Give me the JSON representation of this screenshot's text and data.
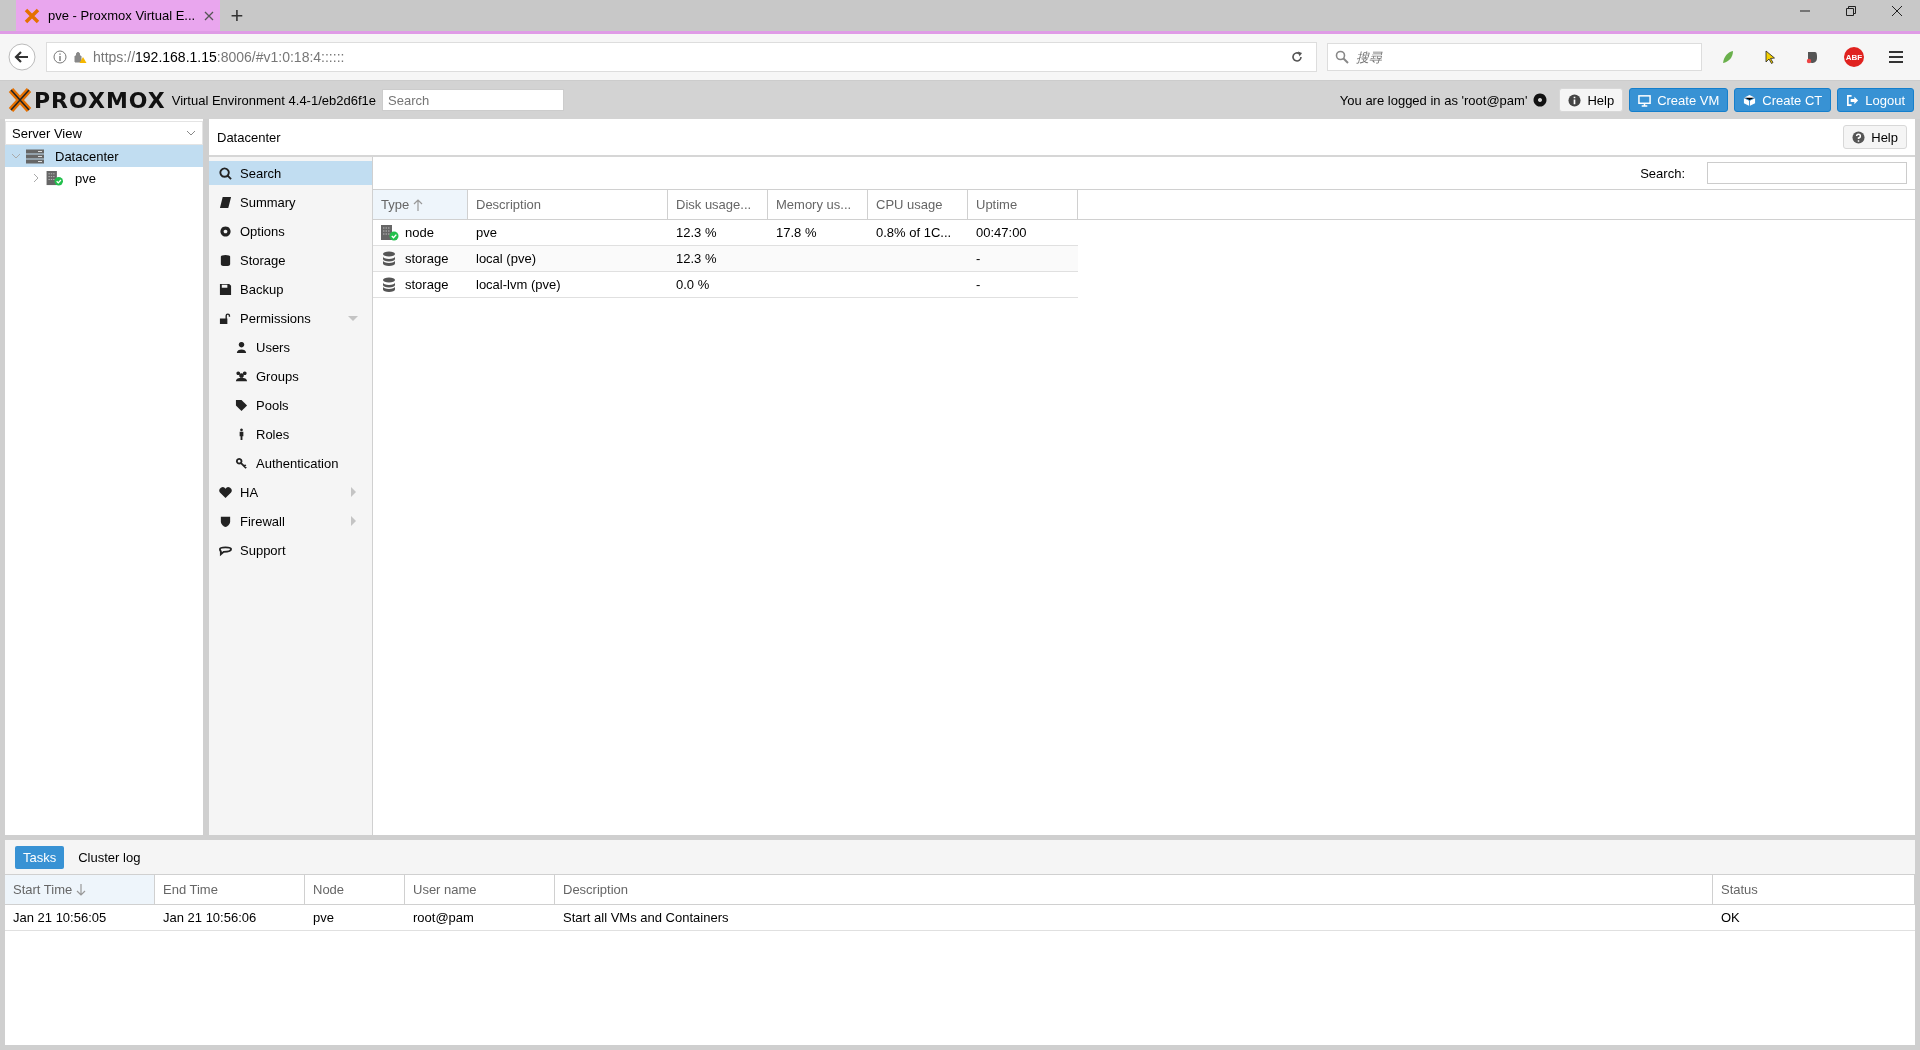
{
  "browser": {
    "tab_title": "pve - Proxmox Virtual E...",
    "new_tab": "+",
    "url": {
      "scheme": "https://",
      "host": "192.168.1.15",
      "rest": ":8006/#v1:0:18:4::::::"
    },
    "search_placeholder": "搜尋",
    "extension_badge": "ABF"
  },
  "header": {
    "logo": "PROXMOX",
    "version": "Virtual Environment 4.4-1/eb2d6f1e",
    "search_placeholder": "Search",
    "login_text": "You are logged in as 'root@pam'",
    "buttons": [
      {
        "label": "Help",
        "kind": "plain"
      },
      {
        "label": "Create VM",
        "kind": "primary"
      },
      {
        "label": "Create CT",
        "kind": "primary"
      },
      {
        "label": "Logout",
        "kind": "primary"
      }
    ]
  },
  "tree": {
    "view": "Server View",
    "items": [
      {
        "label": "Datacenter",
        "selected": true,
        "expanded": true,
        "children": [
          {
            "label": "pve",
            "selected": false,
            "expanded": false
          }
        ]
      }
    ]
  },
  "breadcrumb": "Datacenter",
  "help_button": "Help",
  "menu": [
    {
      "label": "Search",
      "selected": true
    },
    {
      "label": "Summary",
      "selected": false
    },
    {
      "label": "Options",
      "selected": false
    },
    {
      "label": "Storage",
      "selected": false
    },
    {
      "label": "Backup",
      "selected": false
    },
    {
      "label": "Permissions",
      "selected": false,
      "expanded": true,
      "children": [
        {
          "label": "Users",
          "selected": false
        },
        {
          "label": "Groups",
          "selected": false
        },
        {
          "label": "Pools",
          "selected": false
        },
        {
          "label": "Roles",
          "selected": false
        },
        {
          "label": "Authentication",
          "selected": false
        }
      ]
    },
    {
      "label": "HA",
      "selected": false,
      "expanded": false
    },
    {
      "label": "Firewall",
      "selected": false,
      "expanded": false
    },
    {
      "label": "Support",
      "selected": false
    }
  ],
  "search_label": "Search:",
  "grid": {
    "columns": [
      {
        "label": "Type",
        "sorted": true,
        "descending": false
      },
      {
        "label": "Description",
        "sorted": false
      },
      {
        "label": "Disk usage...",
        "sorted": false
      },
      {
        "label": "Memory us...",
        "sorted": false
      },
      {
        "label": "CPU usage",
        "sorted": false
      },
      {
        "label": "Uptime",
        "sorted": false
      }
    ],
    "rows": [
      {
        "kind": "node",
        "cells": [
          "node",
          "pve",
          "12.3 %",
          "17.8 %",
          "0.8% of 1C...",
          "00:47:00"
        ]
      },
      {
        "kind": "storage",
        "cells": [
          "storage",
          "local (pve)",
          "12.3 %",
          "",
          "",
          "-"
        ]
      },
      {
        "kind": "storage",
        "cells": [
          "storage",
          "local-lvm (pve)",
          "0.0 %",
          "",
          "",
          "-"
        ]
      }
    ]
  },
  "bottom": {
    "tabs": [
      {
        "label": "Tasks",
        "selected": true
      },
      {
        "label": "Cluster log",
        "selected": false
      }
    ],
    "columns": [
      {
        "label": "Start Time",
        "sorted": true,
        "descending": true
      },
      {
        "label": "End Time",
        "sorted": false
      },
      {
        "label": "Node",
        "sorted": false
      },
      {
        "label": "User name",
        "sorted": false
      },
      {
        "label": "Description",
        "sorted": false
      },
      {
        "label": "Status",
        "sorted": false
      }
    ],
    "rows": [
      {
        "cells": [
          "Jan 21 10:56:05",
          "Jan 21 10:56:06",
          "pve",
          "root@pam",
          "Start all VMs and Containers",
          "OK"
        ]
      }
    ]
  }
}
